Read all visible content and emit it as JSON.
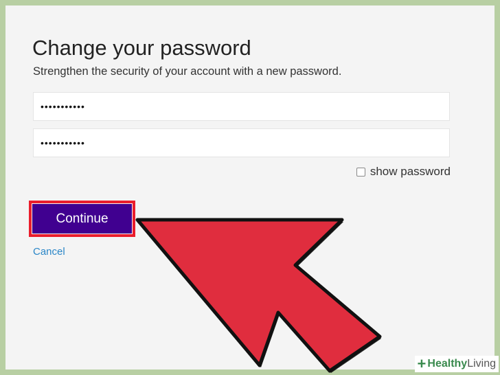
{
  "form": {
    "title": "Change your password",
    "subtitle": "Strengthen the security of your account with a new password.",
    "password_value": "•••••••••••",
    "confirm_password_value": "•••••••••••",
    "show_password_label": "show password",
    "show_password_checked": false,
    "continue_label": "Continue",
    "cancel_label": "Cancel"
  },
  "overlay": {
    "arrow_color": "#e02d3e",
    "highlight_color": "#ea1d2c"
  },
  "watermark": {
    "plus": "+",
    "word1": "Healthy",
    "word2": " Living"
  },
  "colors": {
    "continue_bg": "#400090",
    "link": "#2a86c7",
    "background": "#b8cfa3"
  }
}
